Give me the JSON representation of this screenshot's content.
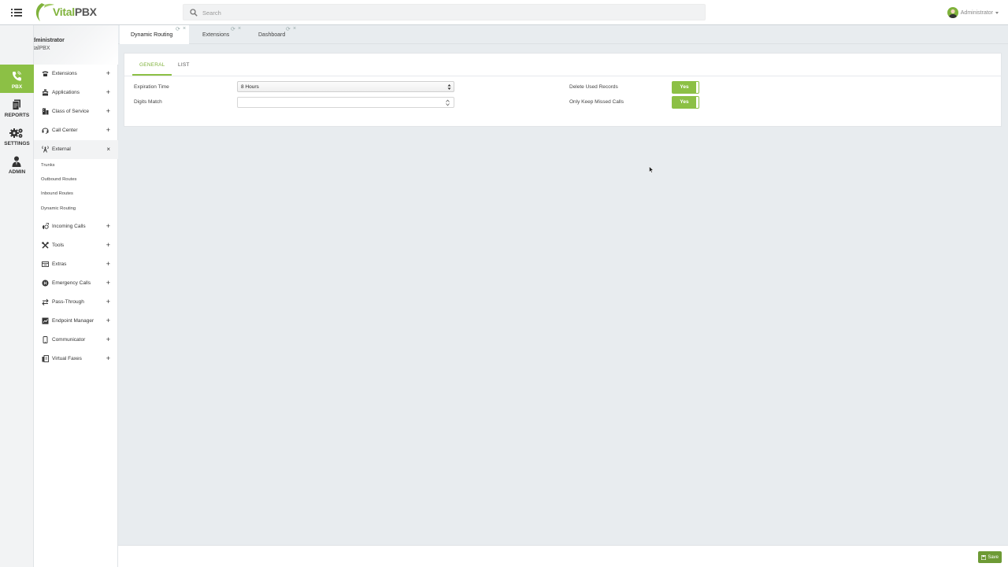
{
  "header": {
    "logo_text_a": "Vital",
    "logo_text_b": "PBX",
    "search_placeholder": "Search",
    "user_name": "Administrator"
  },
  "profile": {
    "name": "Administrator",
    "role": "VitalPBX"
  },
  "rail": [
    {
      "label": "PBX",
      "icon": "phone-icon"
    },
    {
      "label": "REPORTS",
      "icon": "documents-icon"
    },
    {
      "label": "SETTINGS",
      "icon": "gears-icon"
    },
    {
      "label": "ADMIN",
      "icon": "admin-user-icon"
    }
  ],
  "menu": {
    "items": [
      {
        "label": "Extensions",
        "toggle": "+"
      },
      {
        "label": "Applications",
        "toggle": "+"
      },
      {
        "label": "Class of Service",
        "toggle": "+"
      },
      {
        "label": "Call Center",
        "toggle": "+"
      },
      {
        "label": "External",
        "toggle": "×"
      },
      {
        "label": "Incoming Calls",
        "toggle": "+"
      },
      {
        "label": "Tools",
        "toggle": "+"
      },
      {
        "label": "Extras",
        "toggle": "+"
      },
      {
        "label": "Emergency Calls",
        "toggle": "+"
      },
      {
        "label": "Pass-Through",
        "toggle": "+"
      },
      {
        "label": "Endpoint Manager",
        "toggle": "+"
      },
      {
        "label": "Communicator",
        "toggle": "+"
      },
      {
        "label": "Virtual Faxes",
        "toggle": "+"
      }
    ],
    "external_sub": [
      "Trunks",
      "Outbound Routes",
      "Inbound Routes",
      "Dynamic Routing"
    ]
  },
  "page_tabs": [
    {
      "label": "Dynamic Routing"
    },
    {
      "label": "Extensions"
    },
    {
      "label": "Dashboard"
    }
  ],
  "sub_tabs": {
    "general": "GENERAL",
    "list": "LIST"
  },
  "form": {
    "expiration_label": "Expiration Time",
    "expiration_value": "8 Hours",
    "digits_label": "Digits Match",
    "digits_value": "",
    "delete_label": "Delete Used Records",
    "delete_value": "Yes",
    "missed_label": "Only Keep Missed Calls",
    "missed_value": "Yes"
  },
  "footer": {
    "save_label": "Save"
  },
  "colors": {
    "accent": "#8cc045",
    "save": "#6d9a35",
    "content_bg": "#e8ecef"
  }
}
